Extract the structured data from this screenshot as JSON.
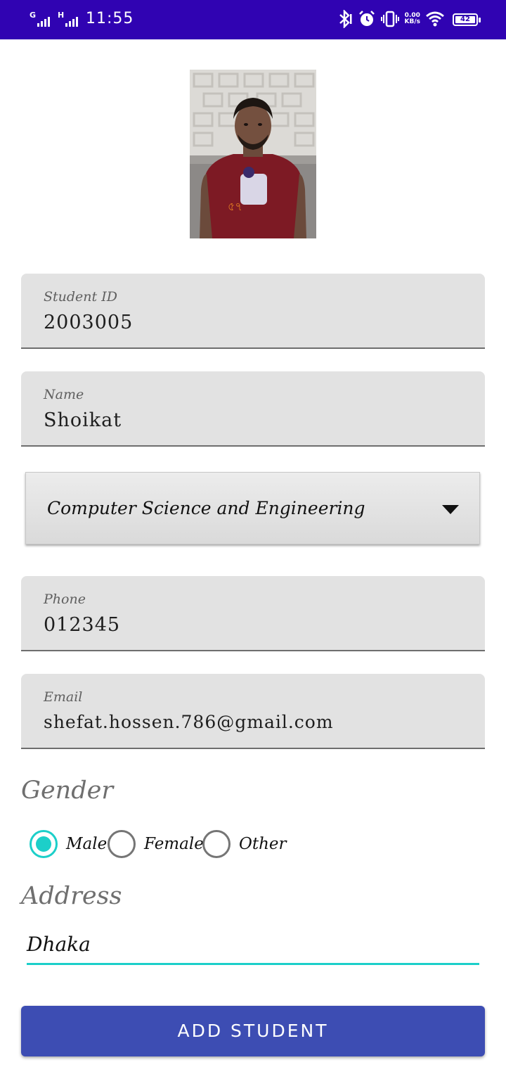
{
  "status_bar": {
    "sim1_label": "G",
    "sim2_label": "H",
    "time": "11:55",
    "net_speed_value": "0.00",
    "net_speed_unit": "KB/s",
    "battery": "42",
    "icons": [
      "bluetooth-icon",
      "alarm-icon",
      "vibrate-icon",
      "wifi-icon",
      "battery-icon"
    ]
  },
  "photo": {
    "subject": "student-photo"
  },
  "form": {
    "student_id": {
      "hint": "Student ID",
      "value": "2003005"
    },
    "name": {
      "hint": "Name",
      "value": "Shoikat"
    },
    "department": {
      "selected": "Computer Science and Engineering"
    },
    "phone": {
      "hint": "Phone",
      "value": "012345"
    },
    "email": {
      "hint": "Email",
      "value": "shefat.hossen.786@gmail.com"
    },
    "gender": {
      "title": "Gender",
      "options": [
        "Male",
        "Female",
        "Other"
      ],
      "selected": "Male"
    },
    "address": {
      "title": "Address",
      "value": "Dhaka"
    },
    "submit_label": "ADD STUDENT"
  },
  "colors": {
    "status_bar": "#3003b2",
    "accent": "#1ccfc9",
    "button": "#3d4db3",
    "field_bg": "#e2e2e2"
  }
}
